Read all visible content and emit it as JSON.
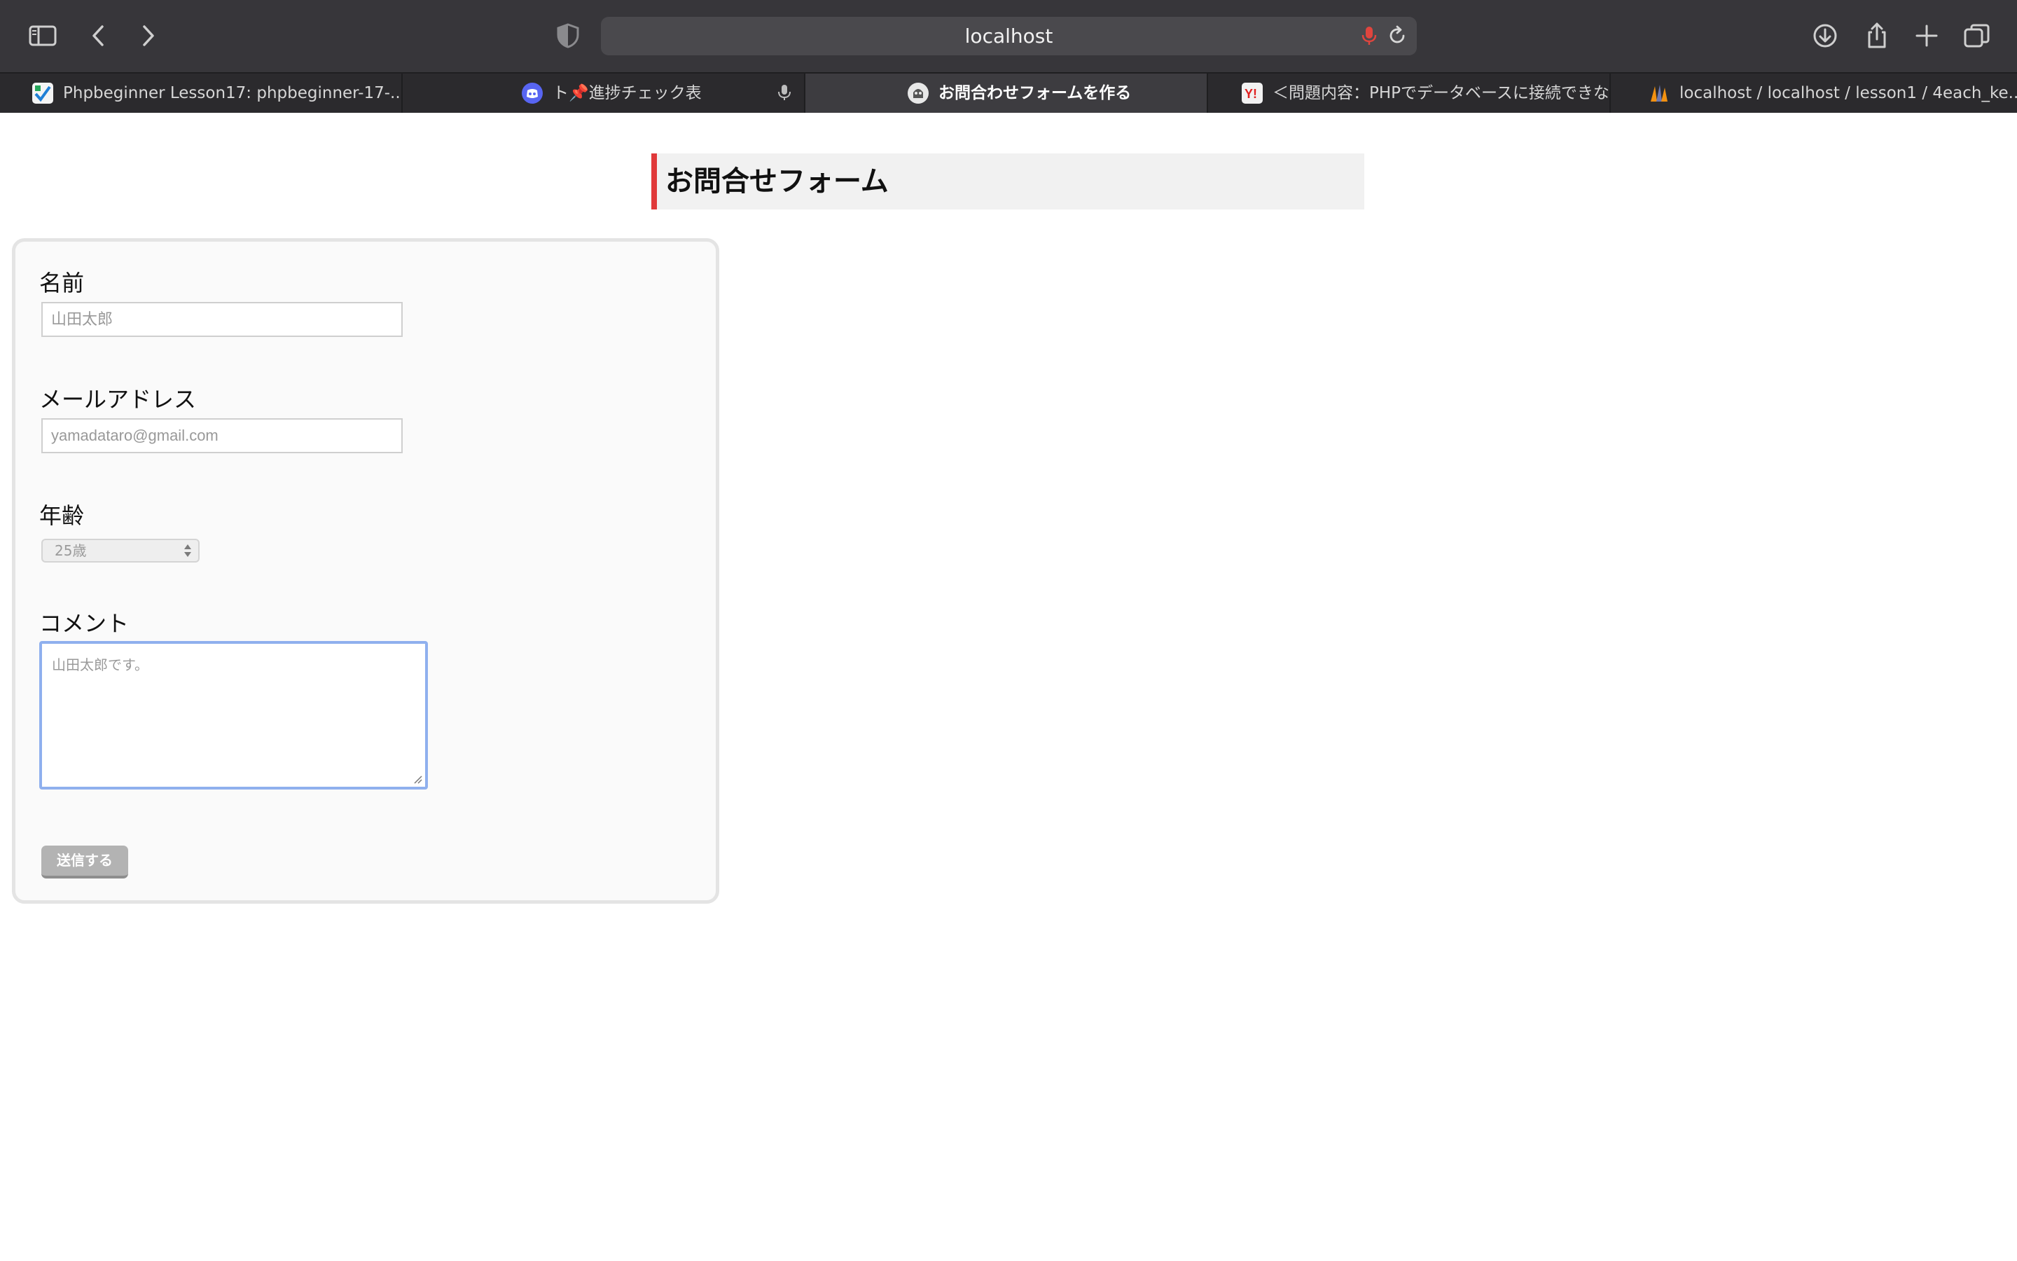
{
  "browser": {
    "address": {
      "url": "localhost"
    },
    "tabs": [
      {
        "title": "Phpbeginner Lesson17: phpbeginner-17-..."
      },
      {
        "title": "ト📌進捗チェック表"
      },
      {
        "title": "お問合わせフォームを作る"
      },
      {
        "title": "＜問題内容：PHPでデータベースに接続できな…"
      },
      {
        "title": "localhost / localhost / lesson1 / 4each_ke..."
      }
    ],
    "icons": [
      "sidebar-icon",
      "back-icon",
      "forward-icon",
      "privacy-shield-icon",
      "microphone-icon",
      "reload-icon",
      "download-icon",
      "share-icon",
      "new-tab-icon",
      "tab-overview-icon"
    ]
  },
  "page": {
    "heading": "お問合せフォーム",
    "fields": {
      "name": {
        "label": "名前",
        "placeholder": "山田太郎"
      },
      "email": {
        "label": "メールアドレス",
        "placeholder": "yamadataro@gmail.com"
      },
      "age": {
        "label": "年齢",
        "selected": "25歳"
      },
      "comment": {
        "label": "コメント",
        "placeholder": "山田太郎です。"
      }
    },
    "submit_label": "送信する"
  },
  "colors": {
    "toolbar": "#37363a",
    "tabbar": "#2b2a2d",
    "heading_accent": "#e0393a",
    "focus_ring": "#8fb0ee",
    "submit_bg": "#b3b3b3"
  }
}
